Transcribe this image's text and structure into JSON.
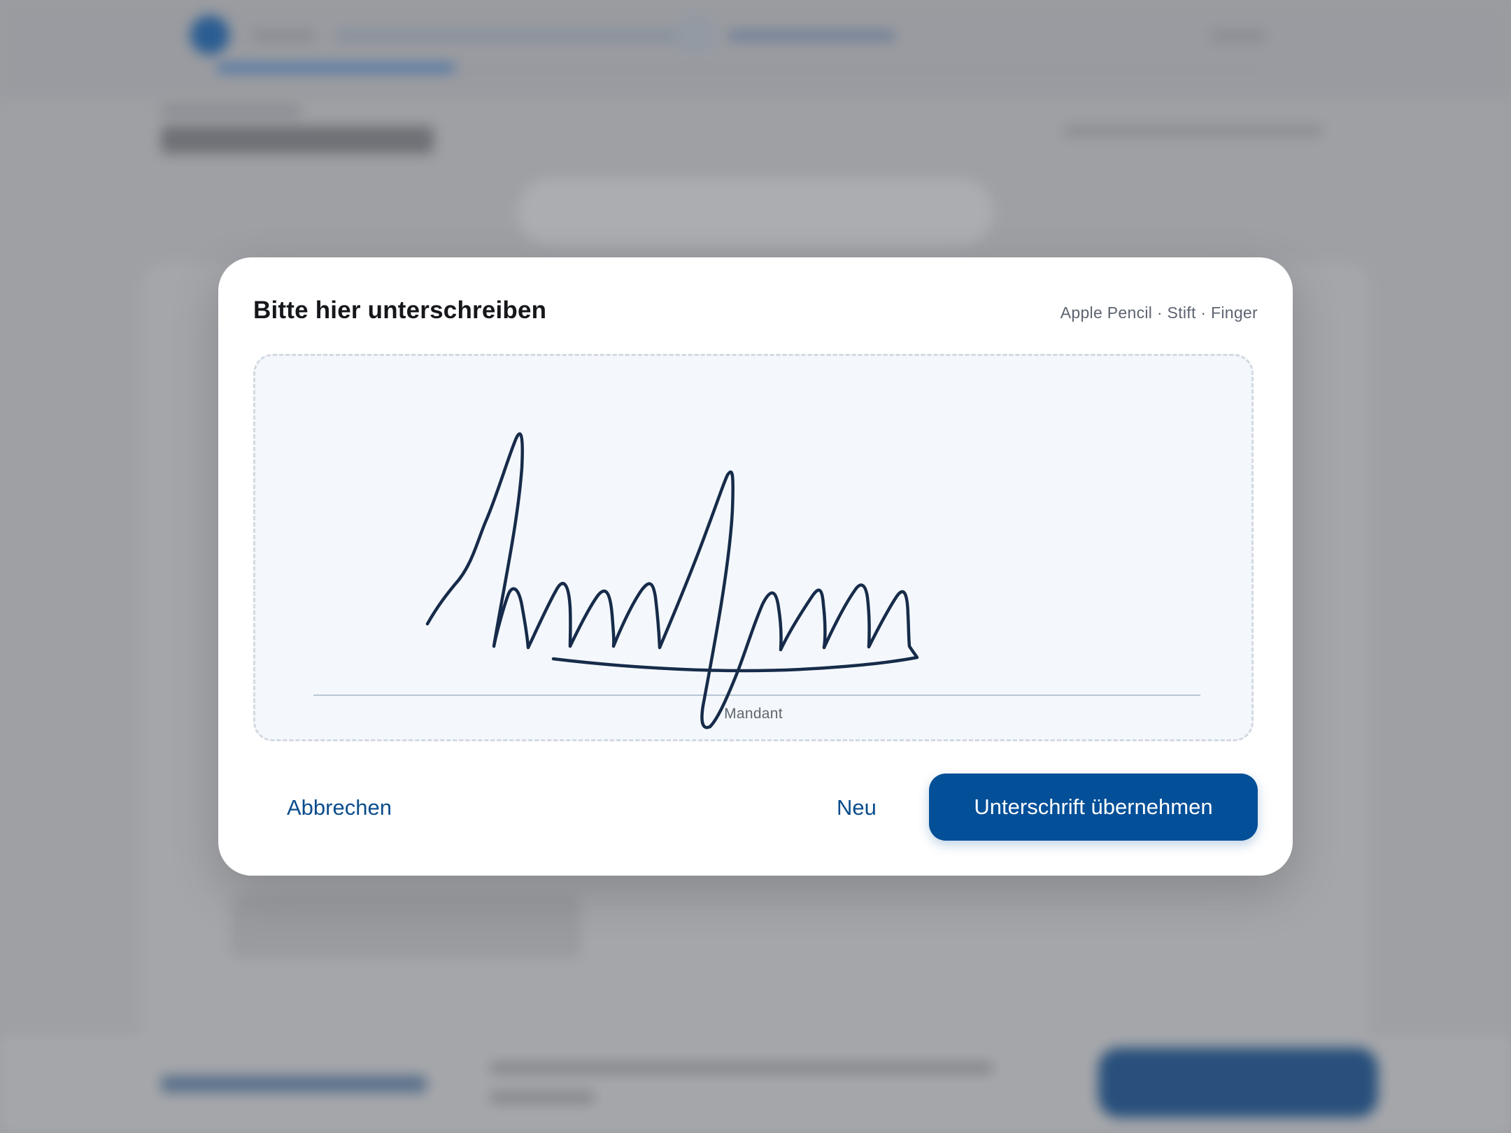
{
  "dialog": {
    "title": "Bitte hier unterschreiben",
    "input_hint": "Apple Pencil · Stift · Finger",
    "signature_line_label": "Mandant",
    "cancel_label": "Abbrechen",
    "new_label": "Neu",
    "accept_label": "Unterschrift übernehmen"
  },
  "colors": {
    "accent": "#034f98",
    "link": "#0a4d8c",
    "signature_ink": "#172b4a",
    "pad_background": "#f4f8fc"
  }
}
